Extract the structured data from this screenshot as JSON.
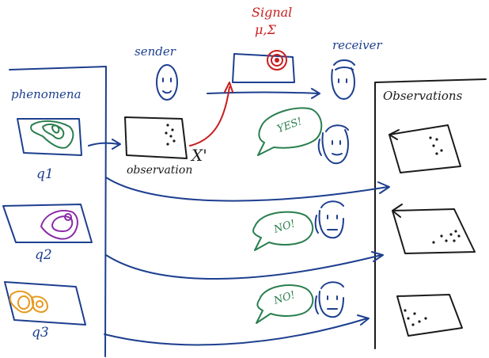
{
  "labels": {
    "signal": "Signal",
    "signal_params": "μ,Σ",
    "sender": "sender",
    "receiver": "receiver",
    "phenomena": "phenomena",
    "observations": "Observations",
    "observation": "observation",
    "x_prime": "X'",
    "q1": "q1",
    "q2": "q2",
    "q3": "q3",
    "yes": "YES!",
    "no_1": "NO!",
    "no_2": "NO!"
  },
  "colors": {
    "ink_blue": "#1d3f8f",
    "ink_red": "#c81d1d",
    "ink_dark": "#1b1b1b",
    "green": "#2a7f4f",
    "purple": "#8a2aa8",
    "orange": "#e59a1f"
  }
}
